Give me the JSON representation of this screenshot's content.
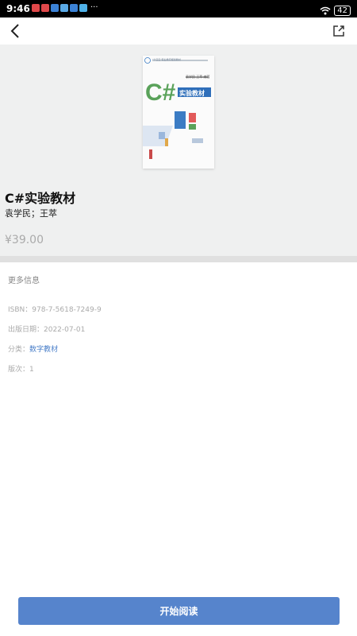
{
  "status_bar": {
    "time": "9:46",
    "battery": "42",
    "notification_colors": [
      "#e0484a",
      "#e0484a",
      "#3b82d6",
      "#5aa9e6",
      "#3b82d6",
      "#4fb1e8"
    ],
    "more": "···"
  },
  "header": {
    "back_icon": "chevron-left-icon",
    "share_icon": "share-external-icon"
  },
  "book": {
    "cover_publisher_line": "\"十四五\"职业教育规划教材",
    "cover_authors": "袁学民 王萃 编著",
    "cover_big": "C#",
    "cover_subtitle": "实验教材",
    "title": "C#实验教材",
    "authors": "袁学民；王萃",
    "price": "¥39.00"
  },
  "more_info": {
    "heading": "更多信息",
    "isbn": "ISBN：978-7-5618-7249-9",
    "pub_date": "出版日期：2022-07-01",
    "category_label": "分类：",
    "category_value": "数字教材",
    "edition": "版次：1"
  },
  "actions": {
    "start_reading": "开始阅读"
  },
  "colors": {
    "accent": "#5684cc",
    "link": "#4a7fc9",
    "hero_bg": "#eff0f0",
    "cover_green": "#5aa25a"
  }
}
